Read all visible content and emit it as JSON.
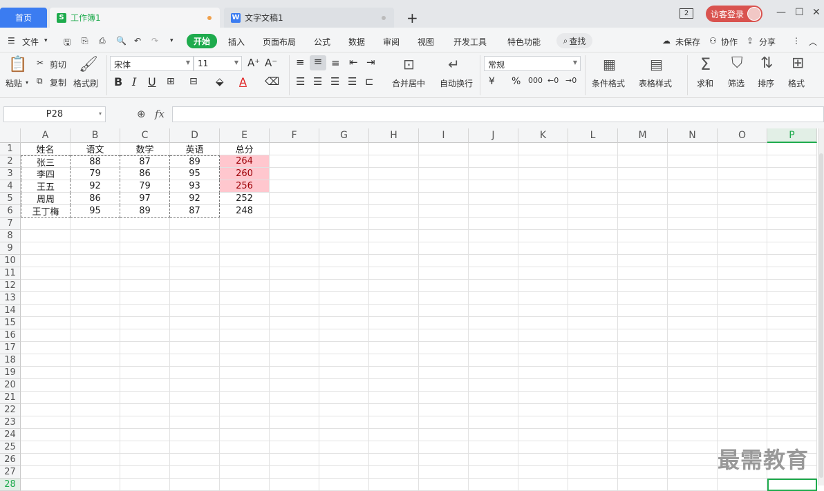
{
  "titlebar": {
    "home_tab": "首页",
    "doc_tabs": [
      {
        "label": "工作簿1",
        "icon": "S",
        "icon_color": "#1eab4d",
        "dot_color": "#f0a04b"
      },
      {
        "label": "文字文稿1",
        "icon": "W",
        "icon_color": "#3b7cf1",
        "dot_color": "#bbbbbb"
      }
    ],
    "new_tab": "+",
    "window_count": "2",
    "login_label": "访客登录"
  },
  "menubar": {
    "file": "文件",
    "start": "开始",
    "items": [
      "插入",
      "页面布局",
      "公式",
      "数据",
      "审阅",
      "视图",
      "开发工具",
      "特色功能"
    ],
    "search": "查找",
    "unsaved": "未保存",
    "collab": "协作",
    "share": "分享"
  },
  "ribbon": {
    "paste": "粘贴",
    "cut": "剪切",
    "copy": "复制",
    "format_painter": "格式刷",
    "font_name": "宋体",
    "font_size": "11",
    "merge_center": "合并居中",
    "auto_wrap": "自动换行",
    "number_format": "常规",
    "cond_format": "条件格式",
    "table_style": "表格样式",
    "sum": "求和",
    "filter": "筛选",
    "sort": "排序",
    "format": "格式"
  },
  "formula_bar": {
    "name_box": "P28",
    "fx": "fx",
    "value": ""
  },
  "sheet": {
    "columns": [
      "A",
      "B",
      "C",
      "D",
      "E",
      "F",
      "G",
      "H",
      "I",
      "J",
      "K",
      "L",
      "M",
      "N",
      "O",
      "P"
    ],
    "rows": [
      "1",
      "2",
      "3",
      "4",
      "5",
      "6",
      "7",
      "8",
      "9",
      "10",
      "11",
      "12",
      "13",
      "14",
      "15",
      "16",
      "17",
      "18",
      "19",
      "20",
      "21",
      "22",
      "23",
      "24",
      "25",
      "26",
      "27",
      "28"
    ],
    "data": [
      [
        "姓名",
        "语文",
        "数学",
        "英语",
        "总分"
      ],
      [
        "张三",
        "88",
        "87",
        "89",
        "264"
      ],
      [
        "李四",
        "79",
        "86",
        "95",
        "260"
      ],
      [
        "王五",
        "92",
        "79",
        "93",
        "256"
      ],
      [
        "周周",
        "86",
        "97",
        "92",
        "252"
      ],
      [
        "王丁梅",
        "95",
        "89",
        "87",
        "248"
      ]
    ],
    "highlight_fill": "#ffc7ce",
    "highlight_text": "#9c0006",
    "selected_col_color": "#1eab4d"
  },
  "watermark": "最需教育"
}
